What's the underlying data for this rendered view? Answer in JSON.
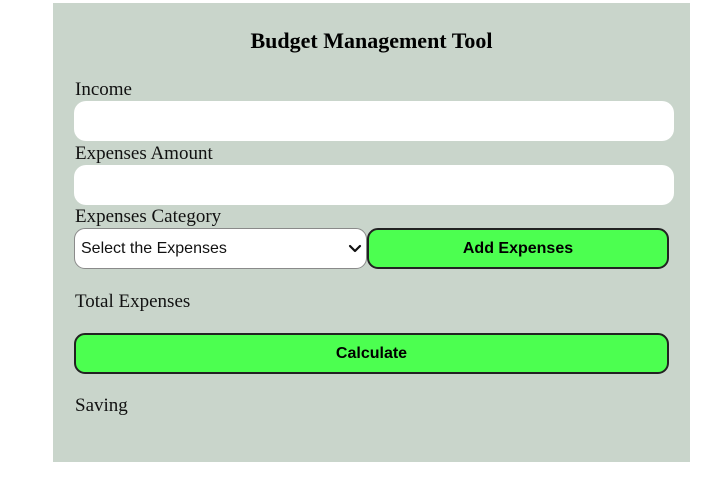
{
  "title": "Budget Management Tool",
  "income": {
    "label": "Income",
    "value": ""
  },
  "expenses_amount": {
    "label": "Expenses Amount",
    "value": ""
  },
  "expenses_category": {
    "label": "Expenses Category",
    "selected": "Select the Expenses"
  },
  "buttons": {
    "add_expenses": "Add Expenses",
    "calculate": "Calculate"
  },
  "total_expenses_label": "Total Expenses",
  "saving_label": "Saving",
  "colors": {
    "panel_bg": "#c9d5cb",
    "button_bg": "#4cff50"
  }
}
